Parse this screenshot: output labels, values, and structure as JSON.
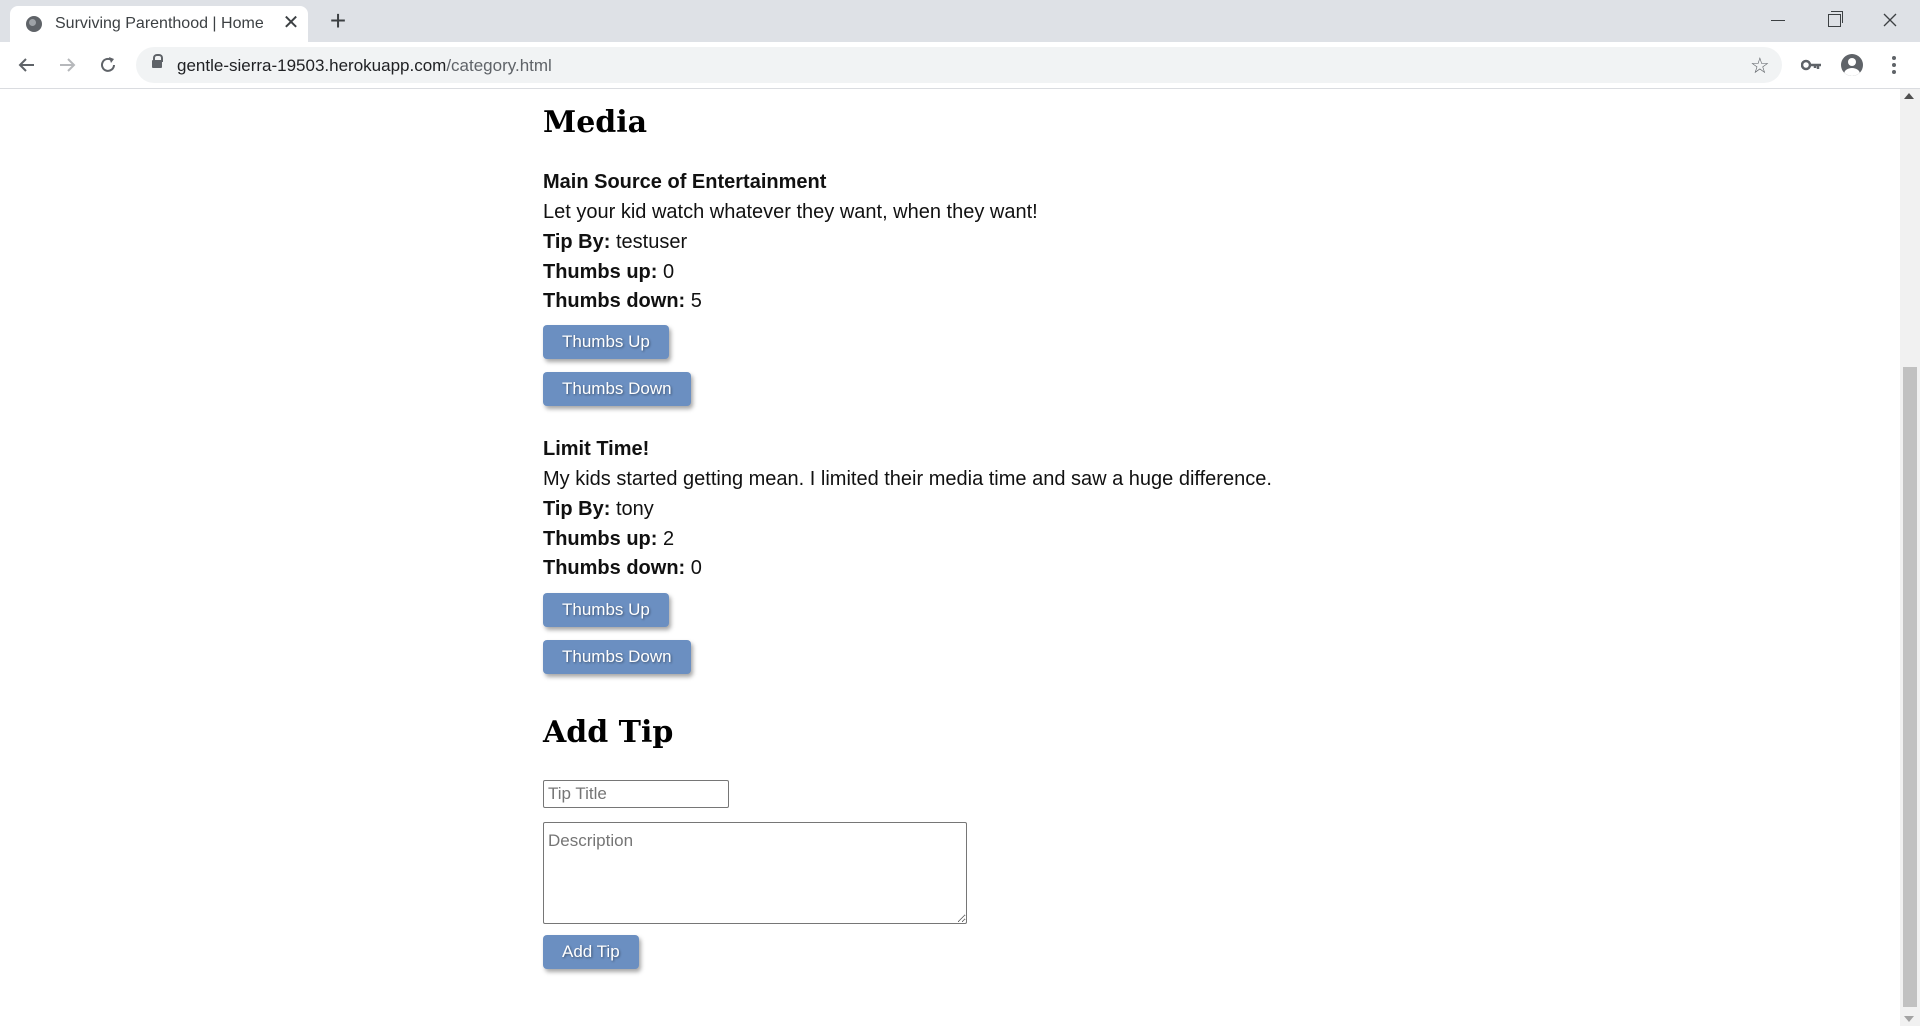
{
  "browser": {
    "tab_title": "Surviving Parenthood | Home",
    "tab_close": "✕",
    "new_tab": "+",
    "url_host": "gentle-sierra-19503.herokuapp.com",
    "url_path": "/category.html"
  },
  "category": {
    "title": "Media"
  },
  "labels": {
    "tip_by": "Tip By:",
    "thumbs_up": "Thumbs up:",
    "thumbs_down": "Thumbs down:",
    "thumbs_up_button": "Thumbs Up",
    "thumbs_down_button": "Thumbs Down"
  },
  "tips": [
    {
      "title": "Main Source of Entertainment",
      "description": "Let your kid watch whatever they want, when they want!",
      "author": "testuser",
      "thumbs_up": "0",
      "thumbs_down": "5"
    },
    {
      "title": "Limit Time!",
      "description": "My kids started getting mean. I limited their media time and saw a huge difference.",
      "author": "tony",
      "thumbs_up": "2",
      "thumbs_down": "0"
    }
  ],
  "add_tip": {
    "heading": "Add Tip",
    "title_placeholder": "Tip Title",
    "description_placeholder": "Description",
    "submit_label": "Add Tip"
  },
  "colors": {
    "button_bg": "#6b8fc1",
    "tabstrip_bg": "#dee1e6"
  }
}
